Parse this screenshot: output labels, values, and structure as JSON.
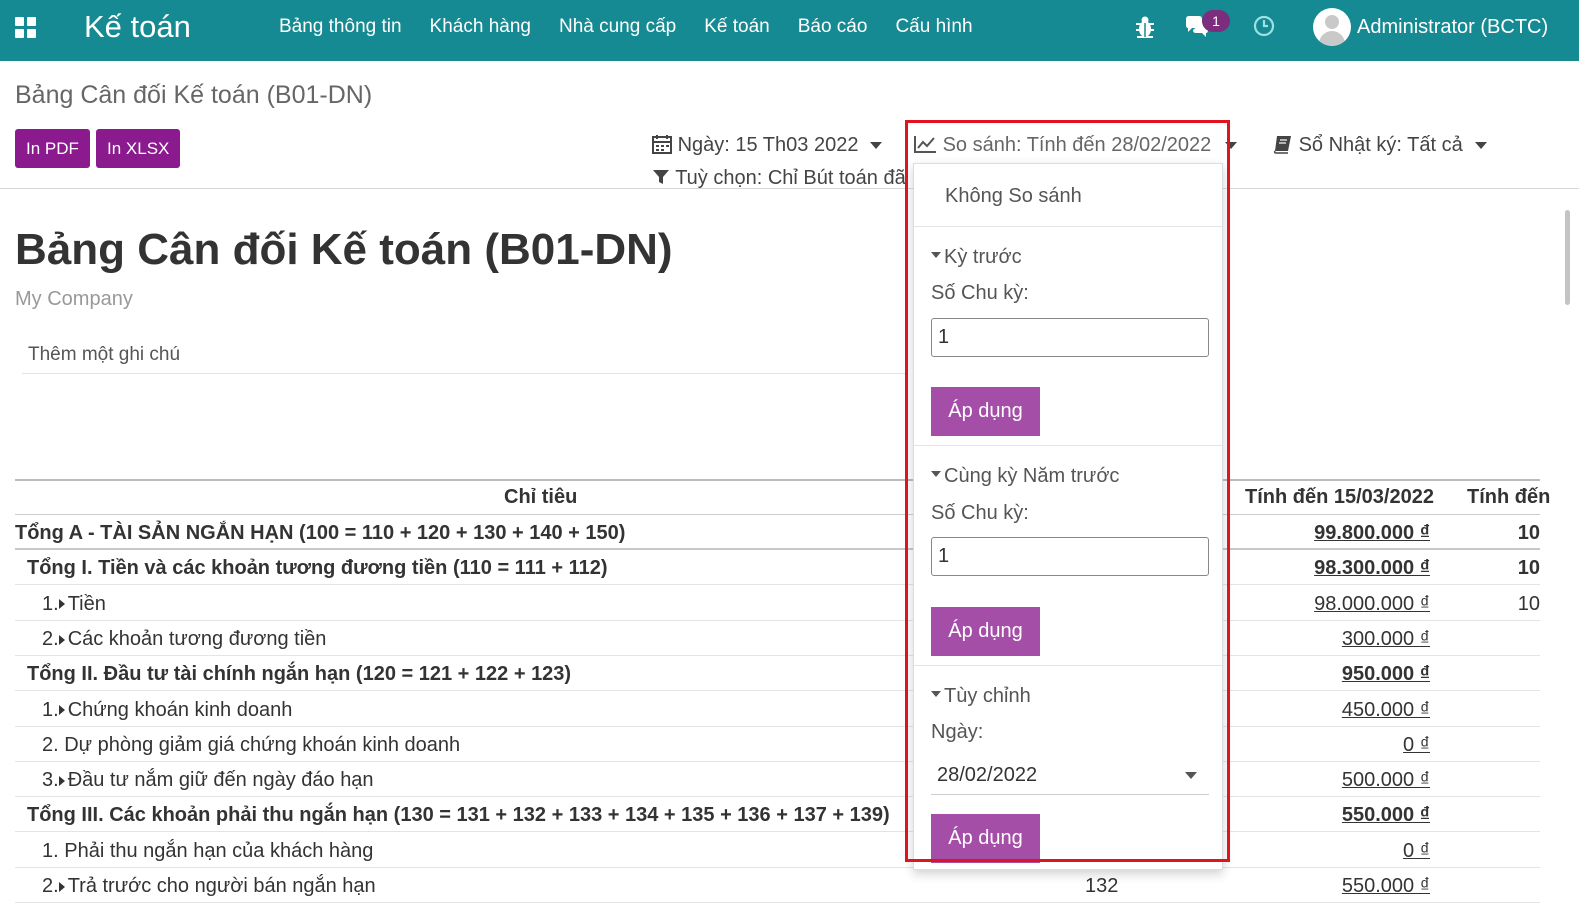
{
  "navbar": {
    "app_name": "Kế toán",
    "menu": [
      "Bảng thông tin",
      "Khách hàng",
      "Nhà cung cấp",
      "Kế toán",
      "Báo cáo",
      "Cấu hình"
    ],
    "message_count": "1",
    "user": "Administrator (BCTC)",
    "color": "#168a92"
  },
  "control_panel": {
    "breadcrumb": "Bảng Cân đối Kế toán (B01-DN)",
    "print_pdf": "In PDF",
    "print_xlsx": "In XLSX",
    "date_filter": "Ngày: 15 Th03 2022",
    "comparison_filter": "So sánh: Tính đến 28/02/2022",
    "journal_filter": "Sổ Nhật ký: Tất cả",
    "options_filter": "Tuỳ chọn: Chỉ Bút toán đã"
  },
  "report": {
    "title": "Bảng Cân đối Kế toán (B01-DN)",
    "company": "My Company",
    "note_placeholder": "Thêm một ghi chú",
    "columns": [
      "Chỉ tiêu",
      "Tính đến 15/03/2022",
      "Tính đến"
    ],
    "rows": [
      {
        "label": "Tổng A - TÀI SẢN NGẮN HẠN (100 = 110 + 120 + 130 + 140 + 150)",
        "code": "",
        "value": "99.800.000 ₫",
        "compare": "10",
        "bold": true,
        "level": 0,
        "expand": false
      },
      {
        "label": "Tổng I. Tiền và các khoản tương đương tiền (110 = 111 + 112)",
        "code": "",
        "value": "98.300.000 ₫",
        "compare": "10",
        "bold": true,
        "level": 1,
        "expand": false
      },
      {
        "label": "Tiền",
        "prefix": "1.",
        "code": "",
        "value": "98.000.000 ₫",
        "compare": "10",
        "bold": false,
        "level": 2,
        "expand": true
      },
      {
        "label": "Các khoản tương đương tiền",
        "prefix": "2.",
        "code": "",
        "value": "300.000 ₫",
        "compare": "",
        "bold": false,
        "level": 2,
        "expand": true
      },
      {
        "label": "Tổng II. Đầu tư tài chính ngắn hạn (120 = 121 + 122 + 123)",
        "code": "",
        "value": "950.000 ₫",
        "compare": "",
        "bold": true,
        "level": 1,
        "expand": false
      },
      {
        "label": "Chứng khoán kinh doanh",
        "prefix": "1.",
        "code": "",
        "value": "450.000 ₫",
        "compare": "",
        "bold": false,
        "level": 2,
        "expand": true
      },
      {
        "label": "2. Dự phòng giảm giá chứng khoán kinh doanh",
        "code": "",
        "value": "0 ₫",
        "compare": "",
        "bold": false,
        "level": 2,
        "expand": false
      },
      {
        "label": "Đầu tư nắm giữ đến ngày đáo hạn",
        "prefix": "3.",
        "code": "",
        "value": "500.000 ₫",
        "compare": "",
        "bold": false,
        "level": 2,
        "expand": true
      },
      {
        "label": "Tổng III. Các khoản phải thu ngắn hạn (130 = 131 + 132 + 133 + 134 + 135 + 136 + 137 + 139)",
        "code": "",
        "value": "550.000 ₫",
        "compare": "",
        "bold": true,
        "level": 1,
        "expand": false
      },
      {
        "label": "1. Phải thu ngắn hạn của khách hàng",
        "code": "",
        "value": "0 ₫",
        "compare": "",
        "bold": false,
        "level": 2,
        "expand": false
      },
      {
        "label": "Trả trước cho người bán ngắn hạn",
        "prefix": "2.",
        "code": "132",
        "value": "550.000 ₫",
        "compare": "",
        "bold": false,
        "level": 2,
        "expand": true
      }
    ]
  },
  "comparison_menu": {
    "no_compare": "Không So sánh",
    "previous_period": "Kỳ trước",
    "period_count_label": "Số Chu kỳ:",
    "previous_period_count": "1",
    "apply": "Áp dụng",
    "same_period_last_year": "Cùng kỳ Năm trước",
    "last_year_count": "1",
    "custom": "Tùy chỉnh",
    "date_label": "Ngày:",
    "custom_date": "28/02/2022"
  },
  "colors": {
    "print_button": "#8b1a8f",
    "apply_button": "#a44ea8",
    "highlight": "#e0141e"
  }
}
